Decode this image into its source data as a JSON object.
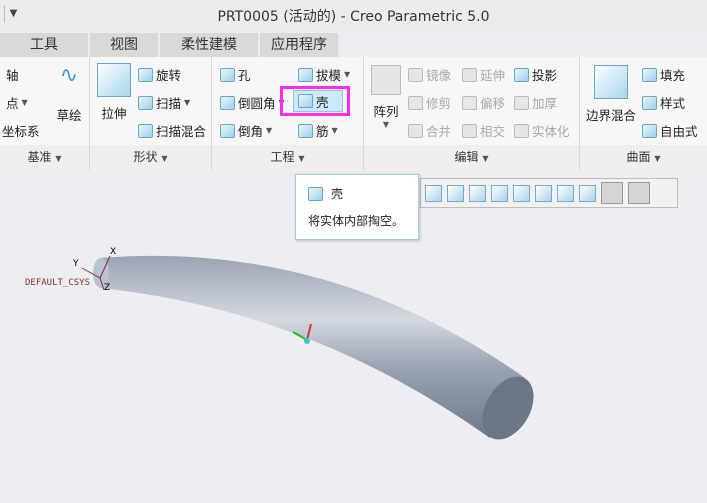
{
  "title": "PRT0005 (活动的) - Creo Parametric 5.0",
  "tabs": [
    "工具",
    "视图",
    "柔性建模",
    "应用程序"
  ],
  "groups": {
    "datum": {
      "label": "基准",
      "items": [
        "轴",
        "点",
        "坐标系",
        "草绘"
      ]
    },
    "shape": {
      "label": "形状",
      "items": [
        "拉伸",
        "旋转",
        "扫描",
        "扫描混合"
      ]
    },
    "engineering": {
      "label": "工程",
      "items": [
        "孔",
        "拔模",
        "倒圆角",
        "壳",
        "倒角",
        "筋"
      ]
    },
    "editing": {
      "label": "编辑",
      "items": [
        "阵列",
        "镜像",
        "延伸",
        "投影",
        "修剪",
        "偏移",
        "加厚",
        "合并",
        "相交",
        "实体化"
      ]
    },
    "surfaces": {
      "label": "曲面",
      "items": [
        "边界混合",
        "填充",
        "样式",
        "自由式"
      ]
    }
  },
  "tooltip": {
    "title": "壳",
    "description": "将实体内部掏空。"
  },
  "csys": {
    "name": "DEFAULT_CSYS",
    "x": "X",
    "y": "Y",
    "z": "Z"
  },
  "colors": {
    "highlight": "#ff2cf0",
    "model": "#8e98a7"
  }
}
